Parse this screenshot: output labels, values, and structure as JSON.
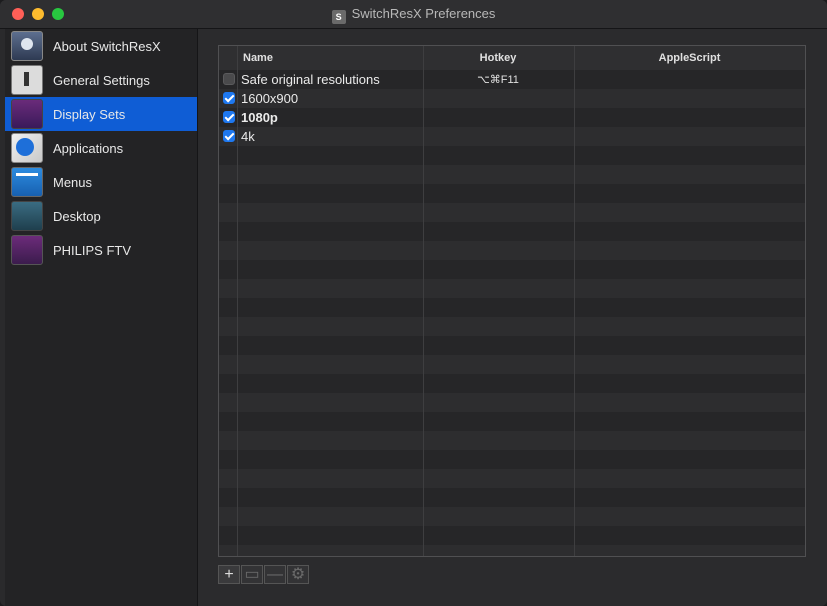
{
  "window": {
    "title": "SwitchResX Preferences",
    "app_icon_glyph": "S"
  },
  "sidebar": {
    "items": [
      {
        "label": "About SwitchResX",
        "icon": "about-icon"
      },
      {
        "label": "General Settings",
        "icon": "general-settings-icon"
      },
      {
        "label": "Display Sets",
        "icon": "display-sets-icon",
        "selected": true
      },
      {
        "label": "Applications",
        "icon": "applications-icon"
      },
      {
        "label": "Menus",
        "icon": "menus-icon"
      },
      {
        "label": "Desktop",
        "icon": "desktop-icon"
      },
      {
        "label": "PHILIPS FTV",
        "icon": "monitor-icon"
      }
    ]
  },
  "table": {
    "columns": {
      "name": "Name",
      "hotkey": "Hotkey",
      "applescript": "AppleScript"
    },
    "rows": [
      {
        "checked": false,
        "name": "Safe original resolutions",
        "hotkey": "⌥⌘F11",
        "applescript": "",
        "bold": false
      },
      {
        "checked": true,
        "name": "1600x900",
        "hotkey": "",
        "applescript": "",
        "bold": false
      },
      {
        "checked": true,
        "name": "1080p",
        "hotkey": "",
        "applescript": "",
        "bold": true
      },
      {
        "checked": true,
        "name": "4k",
        "hotkey": "",
        "applescript": "",
        "bold": false
      }
    ]
  },
  "toolbar": {
    "add": "+",
    "duplicate": "▭",
    "remove": "—",
    "settings": "⚙"
  },
  "colors": {
    "selection": "#0f5dd5",
    "checkbox_checked": "#1e78f0"
  }
}
